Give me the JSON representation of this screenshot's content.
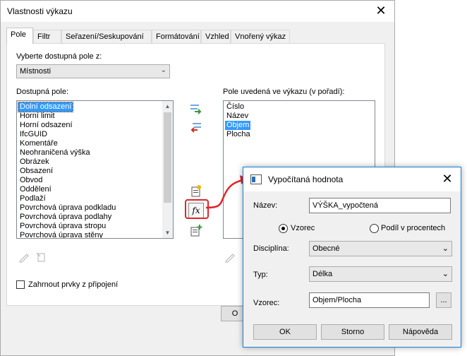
{
  "main_dialog": {
    "title": "Vlastnosti výkazu",
    "tabs": [
      "Pole",
      "Filtr",
      "Seřazení/Seskupování",
      "Formátování",
      "Vzhled",
      "Vnořený výkaz"
    ],
    "active_tab": "Pole",
    "select_fields_label": "Vyberte dostupná pole z:",
    "source_select": {
      "selected": "Místnosti"
    },
    "available_label": "Dostupná pole:",
    "available_fields": [
      "Dolní odsazení",
      "Horní limit",
      "Horní odsazení",
      "IfcGUID",
      "Komentáře",
      "Neohraničená výška",
      "Obrázek",
      "Obsazení",
      "Obvod",
      "Oddělení",
      "Podlaží",
      "Povrchová úprava podkladu",
      "Povrchová úprava podlahy",
      "Povrchová úprava stropu",
      "Povrchová úprava stěny"
    ],
    "available_selected": "Dolní odsazení",
    "scheduled_label": "Pole uvedená ve výkazu (v pořadí):",
    "scheduled_fields": [
      "Číslo",
      "Název",
      "Objem",
      "Plocha"
    ],
    "scheduled_selected": "Objem",
    "include_linked_label": "Zahrnout prvky z připojení",
    "include_linked_checked": false,
    "ok_partial": "O"
  },
  "icons": {
    "add": "arrow-right-add-icon",
    "remove": "arrow-left-remove-icon",
    "new_param": "new-parameter-icon",
    "formula": "formula-fx-icon",
    "combine": "combine-parameters-icon",
    "edit": "pencil-edit-icon",
    "delete": "delete-icon"
  },
  "popup": {
    "title": "Vypočítaná hodnota",
    "name_label": "Název:",
    "name_value": "VÝŠKA_vypočtená",
    "radio_formula": "Vzorec",
    "radio_percent": "Podíl v procentech",
    "radio_selected": "Vzorec",
    "discipline_label": "Disciplína:",
    "discipline_value": "Obecné",
    "type_label": "Typ:",
    "type_value": "Délka",
    "formula_label": "Vzorec:",
    "formula_value": "Objem/Plocha",
    "browse_label": "...",
    "ok": "OK",
    "cancel": "Storno",
    "help": "Nápověda"
  },
  "colors": {
    "selection": "#3399ff",
    "callout": "#e0242a",
    "popup_border": "#1883d7"
  }
}
